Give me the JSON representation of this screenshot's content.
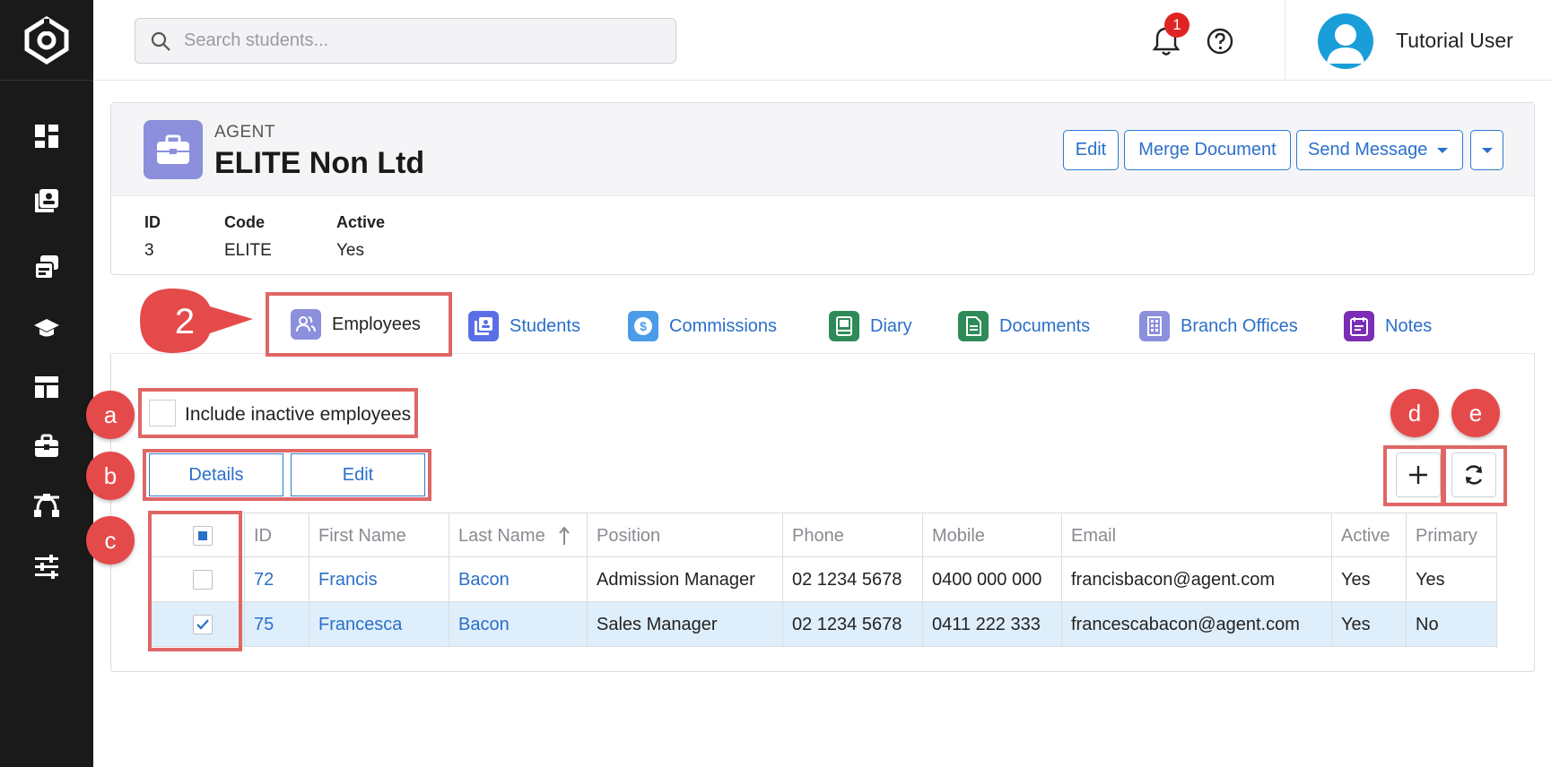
{
  "search": {
    "placeholder": "Search students..."
  },
  "header": {
    "notification_count": "1",
    "user_name": "Tutorial User"
  },
  "record": {
    "type_label": "AGENT",
    "name": "ELITE Non Ltd",
    "actions": {
      "edit": "Edit",
      "merge": "Merge Document",
      "send": "Send Message"
    },
    "fields": [
      {
        "label": "ID",
        "value": "3"
      },
      {
        "label": "Code",
        "value": "ELITE"
      },
      {
        "label": "Active",
        "value": "Yes"
      }
    ]
  },
  "tabs": [
    {
      "label": "Employees",
      "color": "#8b8fdc"
    },
    {
      "label": "Students",
      "color": "#5a6ee6"
    },
    {
      "label": "Commissions",
      "color": "#4a9be8"
    },
    {
      "label": "Diary",
      "color": "#2e8b57"
    },
    {
      "label": "Documents",
      "color": "#2e8b57"
    },
    {
      "label": "Branch Offices",
      "color": "#8b8fdc"
    },
    {
      "label": "Notes",
      "color": "#7b2db5"
    }
  ],
  "employees": {
    "include_inactive_label": "Include inactive employees",
    "details_label": "Details",
    "edit_label": "Edit",
    "columns": [
      "ID",
      "First Name",
      "Last Name",
      "Position",
      "Phone",
      "Mobile",
      "Email",
      "Active",
      "Primary"
    ],
    "rows": [
      {
        "id": "72",
        "first": "Francis",
        "last": "Bacon",
        "position": "Admission Manager",
        "phone": "02 1234 5678",
        "mobile": "0400 000 000",
        "email": "francisbacon@agent.com",
        "active": "Yes",
        "primary": "Yes"
      },
      {
        "id": "75",
        "first": "Francesca",
        "last": "Bacon",
        "position": "Sales Manager",
        "phone": "02 1234 5678",
        "mobile": "0411 222 333",
        "email": "francescabacon@agent.com",
        "active": "Yes",
        "primary": "No"
      }
    ]
  },
  "callouts": {
    "step": "2",
    "a": "a",
    "b": "b",
    "c": "c",
    "d": "d",
    "e": "e"
  },
  "colors": {
    "accent": "#2b6fc9",
    "annotation": "#e54a4a",
    "selected_row": "#dfeefb",
    "sidebar": "#1a1a1a"
  }
}
